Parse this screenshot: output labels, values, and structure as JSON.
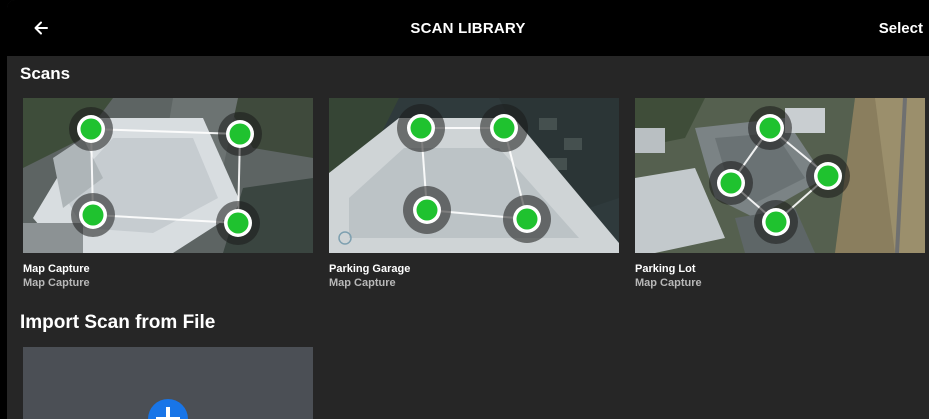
{
  "header": {
    "title": "SCAN LIBRARY",
    "select_label": "Select",
    "back_icon": "arrow-left-icon"
  },
  "sections": {
    "scans_title": "Scans",
    "import_title": "Import Scan from File"
  },
  "scans": [
    {
      "name": "Map Capture",
      "type": "Map Capture"
    },
    {
      "name": "Parking Garage",
      "type": "Map Capture"
    },
    {
      "name": "Parking Lot",
      "type": "Map Capture"
    }
  ],
  "import": {
    "icon": "plus-icon"
  },
  "colors": {
    "waypoint": "#1fc22f",
    "accent": "#1875e8",
    "background": "#262626",
    "header": "#000000"
  }
}
